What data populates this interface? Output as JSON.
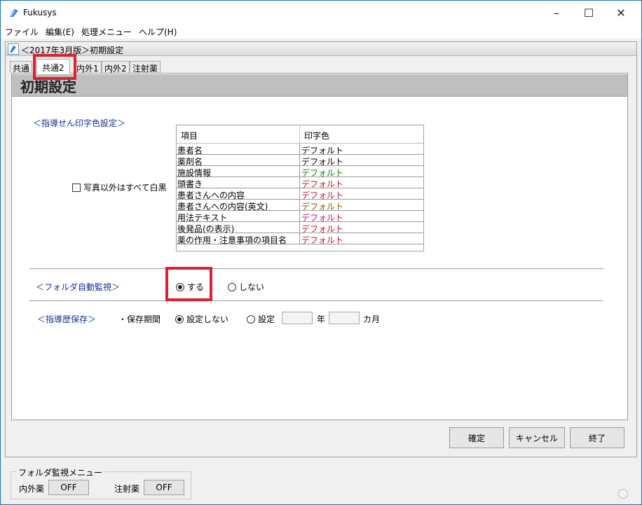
{
  "window": {
    "title": "Fukusys",
    "minimize_glyph": "–",
    "maximize_glyph": "☐",
    "close_glyph": "✕"
  },
  "menu": [
    "ファイル",
    "編集(E)",
    "処理メニュー",
    "ヘルプ(H)"
  ],
  "document": {
    "title": "＜2017年3月版＞初期設定"
  },
  "tabs": [
    {
      "label": "共通",
      "active": false
    },
    {
      "label": "共通2",
      "active": true
    },
    {
      "label": "内外1",
      "active": false
    },
    {
      "label": "内外2",
      "active": false
    },
    {
      "label": "注射薬",
      "active": false
    }
  ],
  "page_title": "初期設定",
  "print_color": {
    "section_label": "＜指導せん印字色設定＞",
    "bw_checkbox": {
      "label": "写真以外はすべて白黒",
      "checked": false
    },
    "table": {
      "headers": [
        "項目",
        "印字色"
      ],
      "rows": [
        {
          "item": "患者名",
          "color": "デフォルト",
          "text_color": "#000000"
        },
        {
          "item": "薬剤名",
          "color": "デフォルト",
          "text_color": "#000000"
        },
        {
          "item": "施設情報",
          "color": "デフォルト",
          "text_color": "#1a7a1a"
        },
        {
          "item": "頭書き",
          "color": "デフォルト",
          "text_color": "#c8102e"
        },
        {
          "item": "患者さんへの内容",
          "color": "デフォルト",
          "text_color": "#c8102e"
        },
        {
          "item": "患者さんへの内容(英文)",
          "color": "デフォルト",
          "text_color": "#8a5a00"
        },
        {
          "item": "用法テキスト",
          "color": "デフォルト",
          "text_color": "#c8106e"
        },
        {
          "item": "後発品(の表示)",
          "color": "デフォルト",
          "text_color": "#c8102e"
        },
        {
          "item": "薬の作用・注意事項の項目名",
          "color": "デフォルト",
          "text_color": "#c8102e"
        }
      ]
    }
  },
  "folder_monitor": {
    "section_label": "＜フォルダ自動監視＞",
    "options": [
      {
        "label": "する",
        "checked": true
      },
      {
        "label": "しない",
        "checked": false
      }
    ]
  },
  "history": {
    "section_label": "＜指導歴保存＞",
    "period_label": "・保存期間",
    "options": [
      {
        "label": "設定しない",
        "checked": true
      },
      {
        "label": "設定",
        "checked": false
      }
    ],
    "year_value": "",
    "year_unit": "年",
    "month_value": "",
    "month_unit": "カ月"
  },
  "buttons": {
    "confirm": "確定",
    "cancel": "キャンセル",
    "exit": "終了"
  },
  "status": {
    "group_title": "フォルダ監視メニュー",
    "internal_label": "内外薬",
    "internal_value": "OFF",
    "injection_label": "注射薬",
    "injection_value": "OFF"
  },
  "colors": {
    "accent": "#1a6fc4",
    "section_label": "#1a2c9a",
    "highlight": "#e0202f"
  }
}
